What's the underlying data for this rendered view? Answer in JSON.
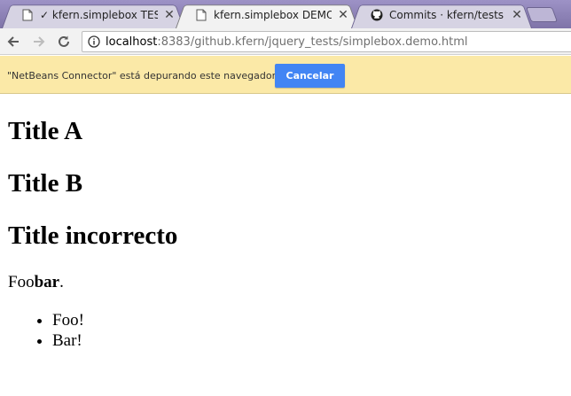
{
  "tabs": [
    {
      "title": "✓ kfern.simplebox TESTS",
      "favicon": "page-icon",
      "close": "✕"
    },
    {
      "title": "kfern.simplebox DEMO",
      "favicon": "page-icon",
      "close": "✕"
    },
    {
      "title": "Commits · kfern/tests",
      "favicon": "github-icon",
      "close": "✕"
    }
  ],
  "toolbar": {
    "back_icon": "back-arrow-icon",
    "forward_icon": "forward-arrow-icon",
    "reload_icon": "reload-icon",
    "url_host": "localhost",
    "url_rest": ":8383/github.kfern/jquery_tests/simplebox.demo.html"
  },
  "infobar": {
    "message": "\"NetBeans Connector\" está depurando este navegador.",
    "cancel_label": "Cancelar",
    "button_color": "#4285f4",
    "background": "#fbe9a7"
  },
  "page": {
    "headings": [
      "Title A",
      "Title B",
      "Title incorrecto"
    ],
    "paragraph_pre": "Foo",
    "paragraph_bold": "bar",
    "paragraph_post": ".",
    "list_items": [
      "Foo!",
      "Bar!"
    ]
  }
}
